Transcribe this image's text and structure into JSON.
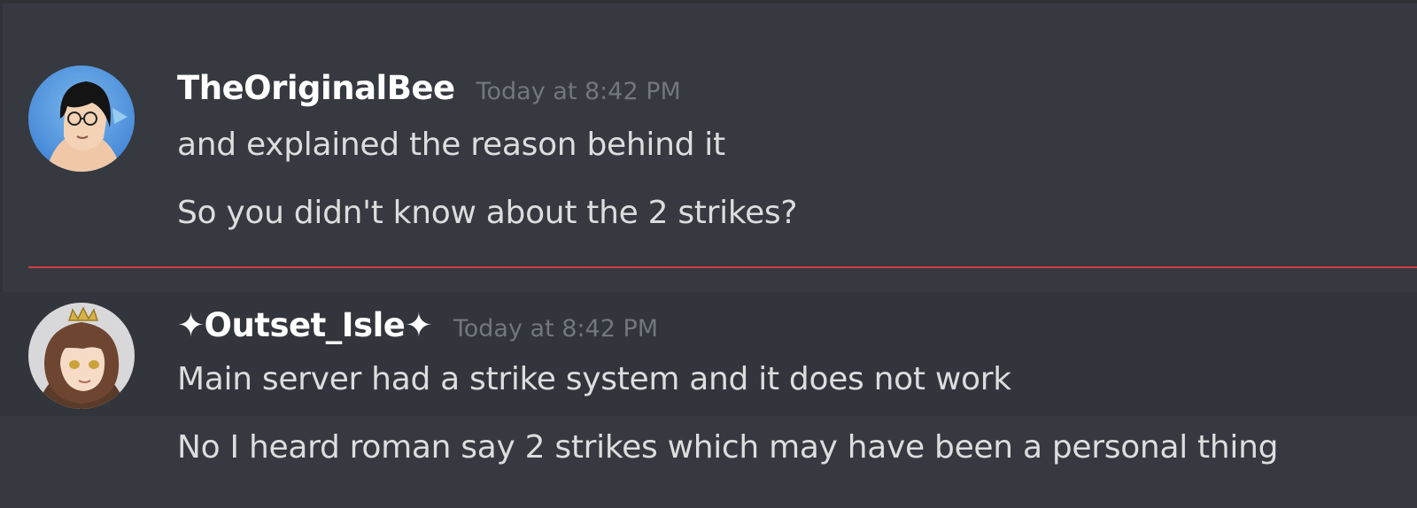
{
  "messages": [
    {
      "author": "TheOriginalBee",
      "timestamp": "Today at 8:42 PM",
      "lines": [
        "and explained the reason behind it",
        "So you didn't know about the 2 strikes?"
      ]
    },
    {
      "author": "✦Outset_Isle✦",
      "timestamp": "Today at 8:42 PM",
      "lines": [
        "Main server had a strike system and it does not work",
        "No I heard roman say 2 strikes which may have been a personal thing"
      ]
    }
  ],
  "colors": {
    "background": "#36393f",
    "new_messages_divider": "#ed4245",
    "username": "#ffffff",
    "timestamp": "#72767d",
    "message_text": "#dcddde"
  }
}
